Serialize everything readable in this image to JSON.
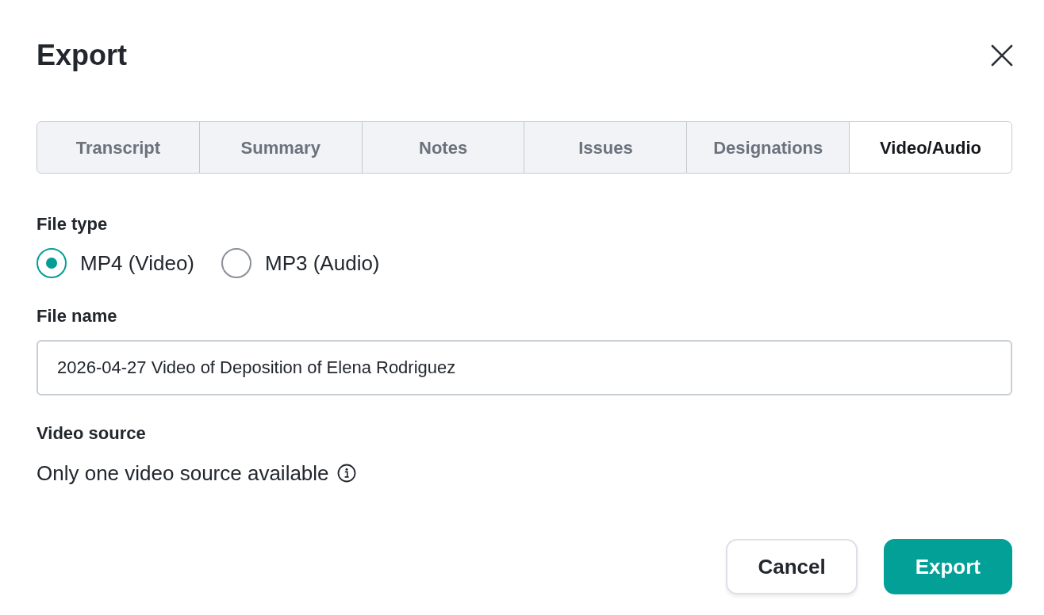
{
  "dialog": {
    "title": "Export"
  },
  "tabs": [
    {
      "label": "Transcript",
      "selected": false
    },
    {
      "label": "Summary",
      "selected": false
    },
    {
      "label": "Notes",
      "selected": false
    },
    {
      "label": "Issues",
      "selected": false
    },
    {
      "label": "Designations",
      "selected": false
    },
    {
      "label": "Video/Audio",
      "selected": true
    }
  ],
  "file_type": {
    "label": "File type",
    "options": [
      {
        "label": "MP4 (Video)",
        "selected": true
      },
      {
        "label": "MP3 (Audio)",
        "selected": false
      }
    ]
  },
  "file_name": {
    "label": "File name",
    "value": "2026-04-27 Video of Deposition of Elena Rodriguez"
  },
  "video_source": {
    "label": "Video source",
    "text": "Only one video source available"
  },
  "buttons": [
    {
      "label": "Cancel",
      "kind": "secondary"
    },
    {
      "label": "Export",
      "kind": "primary"
    }
  ]
}
